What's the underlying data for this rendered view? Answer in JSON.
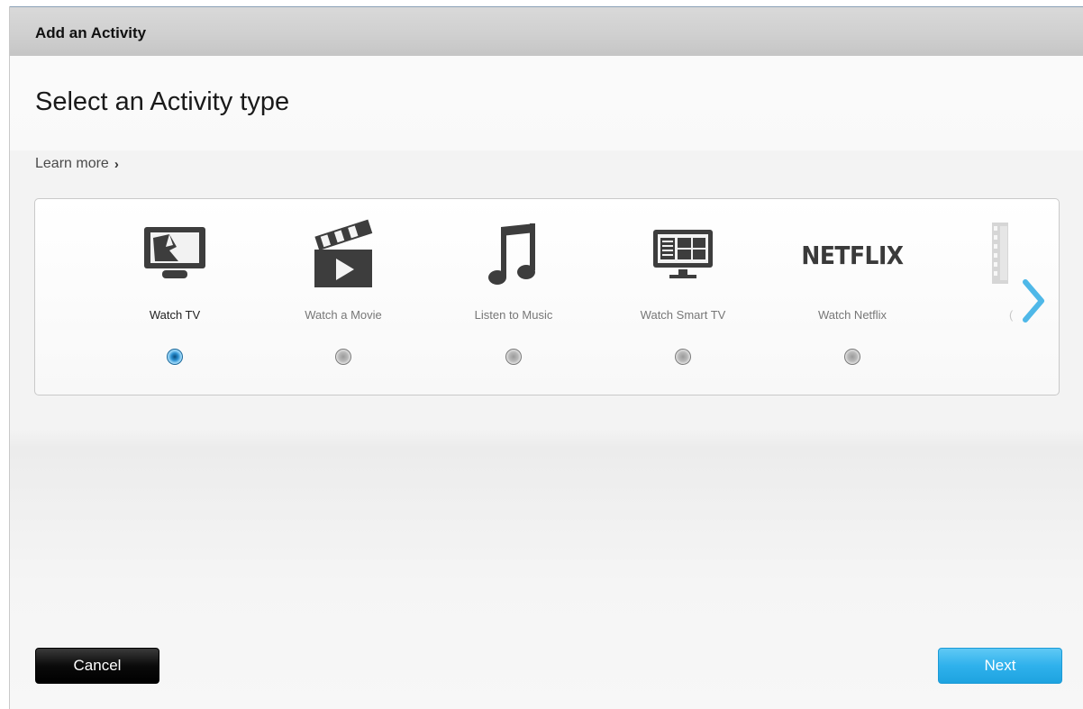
{
  "dialog": {
    "title": "Add an Activity",
    "heading": "Select an Activity type",
    "learn_more": "Learn more",
    "learn_more_chevron": "›"
  },
  "activities": [
    {
      "label": "Watch TV",
      "icon": "tv-icon",
      "selected": true
    },
    {
      "label": "Watch a Movie",
      "icon": "movie-clapper-icon",
      "selected": false
    },
    {
      "label": "Listen to Music",
      "icon": "music-note-icon",
      "selected": false
    },
    {
      "label": "Watch Smart TV",
      "icon": "smart-tv-icon",
      "selected": false
    },
    {
      "label": "Watch Netflix",
      "icon": "netflix-logo",
      "selected": false
    }
  ],
  "partial_activity": {
    "icon": "film-strip-icon",
    "label_fragment": "("
  },
  "netflix_logo_text": "NETFLIX",
  "buttons": {
    "cancel": "Cancel",
    "next": "Next"
  },
  "colors": {
    "accent": "#2fb1ec",
    "arrow": "#4fb8e8",
    "cancel_bg": "#000000"
  }
}
